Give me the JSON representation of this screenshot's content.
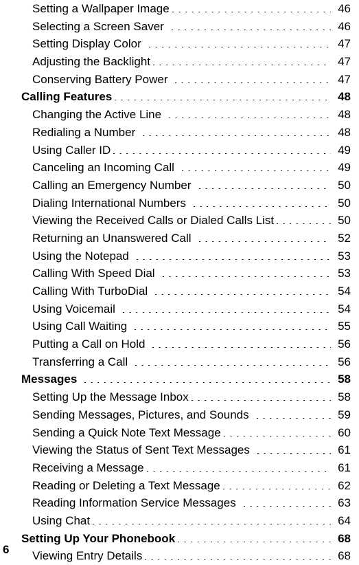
{
  "document": {
    "type": "table-of-contents",
    "folio": "6",
    "leader_char": "."
  },
  "toc": {
    "entries": [
      {
        "label": "Setting a Wallpaper Image",
        "page": "46",
        "level": 1,
        "gap": false
      },
      {
        "label": "Selecting a Screen Saver",
        "page": "46",
        "level": 1,
        "gap": true
      },
      {
        "label": "Setting Display Color",
        "page": "47",
        "level": 1,
        "gap": true
      },
      {
        "label": "Adjusting the Backlight",
        "page": "47",
        "level": 1,
        "gap": false
      },
      {
        "label": "Conserving Battery Power",
        "page": "47",
        "level": 1,
        "gap": true
      },
      {
        "label": "Calling Features",
        "page": "48",
        "level": 0,
        "gap": false
      },
      {
        "label": "Changing the Active Line",
        "page": "48",
        "level": 1,
        "gap": true
      },
      {
        "label": "Redialing a Number",
        "page": "48",
        "level": 1,
        "gap": true
      },
      {
        "label": "Using Caller ID",
        "page": "49",
        "level": 1,
        "gap": false
      },
      {
        "label": "Canceling an Incoming Call",
        "page": "49",
        "level": 1,
        "gap": true
      },
      {
        "label": "Calling an Emergency Number",
        "page": "50",
        "level": 1,
        "gap": true
      },
      {
        "label": "Dialing International Numbers",
        "page": "50",
        "level": 1,
        "gap": true
      },
      {
        "label": "Viewing the Received Calls or Dialed Calls List",
        "page": "50",
        "level": 1,
        "gap": false
      },
      {
        "label": "Returning an Unanswered Call",
        "page": "52",
        "level": 1,
        "gap": true
      },
      {
        "label": "Using the Notepad",
        "page": "53",
        "level": 1,
        "gap": true
      },
      {
        "label": "Calling With Speed Dial",
        "page": "53",
        "level": 1,
        "gap": true
      },
      {
        "label": "Calling With TurboDial",
        "page": "54",
        "level": 1,
        "gap": true
      },
      {
        "label": "Using Voicemail",
        "page": "54",
        "level": 1,
        "gap": true
      },
      {
        "label": "Using Call Waiting",
        "page": "55",
        "level": 1,
        "gap": true
      },
      {
        "label": "Putting a Call on Hold",
        "page": "56",
        "level": 1,
        "gap": true
      },
      {
        "label": "Transferring a Call",
        "page": "56",
        "level": 1,
        "gap": true
      },
      {
        "label": "Messages",
        "page": "58",
        "level": 0,
        "gap": true
      },
      {
        "label": "Setting Up the Message Inbox",
        "page": "58",
        "level": 1,
        "gap": false
      },
      {
        "label": "Sending Messages, Pictures, and Sounds",
        "page": "59",
        "level": 1,
        "gap": true
      },
      {
        "label": "Sending a Quick Note Text Message",
        "page": "60",
        "level": 1,
        "gap": false
      },
      {
        "label": "Viewing the Status of Sent Text Messages",
        "page": "61",
        "level": 1,
        "gap": true
      },
      {
        "label": "Receiving a Message",
        "page": "61",
        "level": 1,
        "gap": false
      },
      {
        "label": "Reading or Deleting a Text Message",
        "page": "62",
        "level": 1,
        "gap": false
      },
      {
        "label": "Reading Information Service Messages",
        "page": "63",
        "level": 1,
        "gap": true
      },
      {
        "label": "Using Chat",
        "page": "64",
        "level": 1,
        "gap": false
      },
      {
        "label": "Setting Up Your Phonebook",
        "page": "68",
        "level": 0,
        "gap": false
      },
      {
        "label": "Viewing Entry Details",
        "page": "68",
        "level": 1,
        "gap": false
      }
    ]
  }
}
